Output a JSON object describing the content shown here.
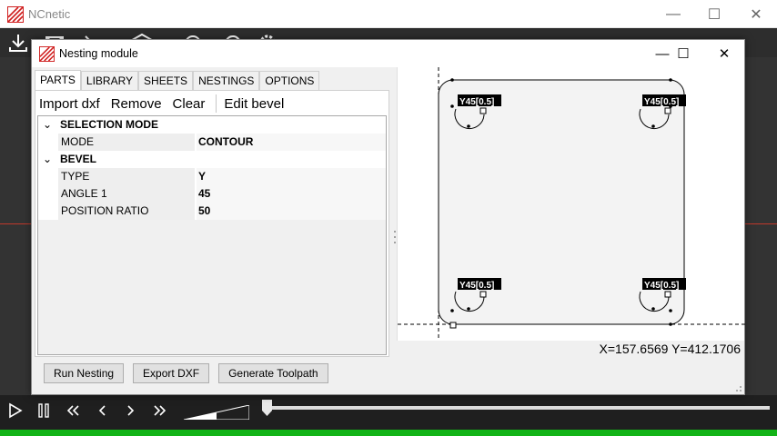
{
  "app": {
    "title": "NCnetic"
  },
  "dialog": {
    "title": "Nesting module",
    "tabs": [
      "PARTS",
      "LIBRARY",
      "SHEETS",
      "NESTINGS",
      "OPTIONS"
    ],
    "actions": [
      "Import dxf",
      "Remove",
      "Clear",
      "Edit bevel"
    ],
    "properties": {
      "group1": "SELECTION MODE",
      "mode_label": "MODE",
      "mode_value": "CONTOUR",
      "group2": "BEVEL",
      "type_label": "TYPE",
      "type_value": "Y",
      "angle_label": "ANGLE 1",
      "angle_value": "45",
      "ratio_label": "POSITION RATIO",
      "ratio_value": "50"
    },
    "buttons": [
      "Run Nesting",
      "Export DXF",
      "Generate Toolpath"
    ],
    "canvas": {
      "bevel_labels": [
        "Y45[0.5]",
        "Y45[0.5]",
        "Y45[0.5]",
        "Y45[0.5]"
      ],
      "coordinates": "X=157.6569 Y=412.1706"
    }
  },
  "colors": {
    "accent_red": "#c0392b",
    "status_green": "#12b317",
    "toolbar_dark": "#2d2d2d"
  },
  "icons": [
    "download-icon",
    "mail-icon",
    "chevron-right-icon",
    "cube-icon",
    "clock-icon",
    "gauge-icon",
    "gear-icon",
    "play-icon",
    "pause-icon",
    "rewind-icon",
    "step-back-icon",
    "step-forward-icon",
    "fast-forward-icon"
  ]
}
